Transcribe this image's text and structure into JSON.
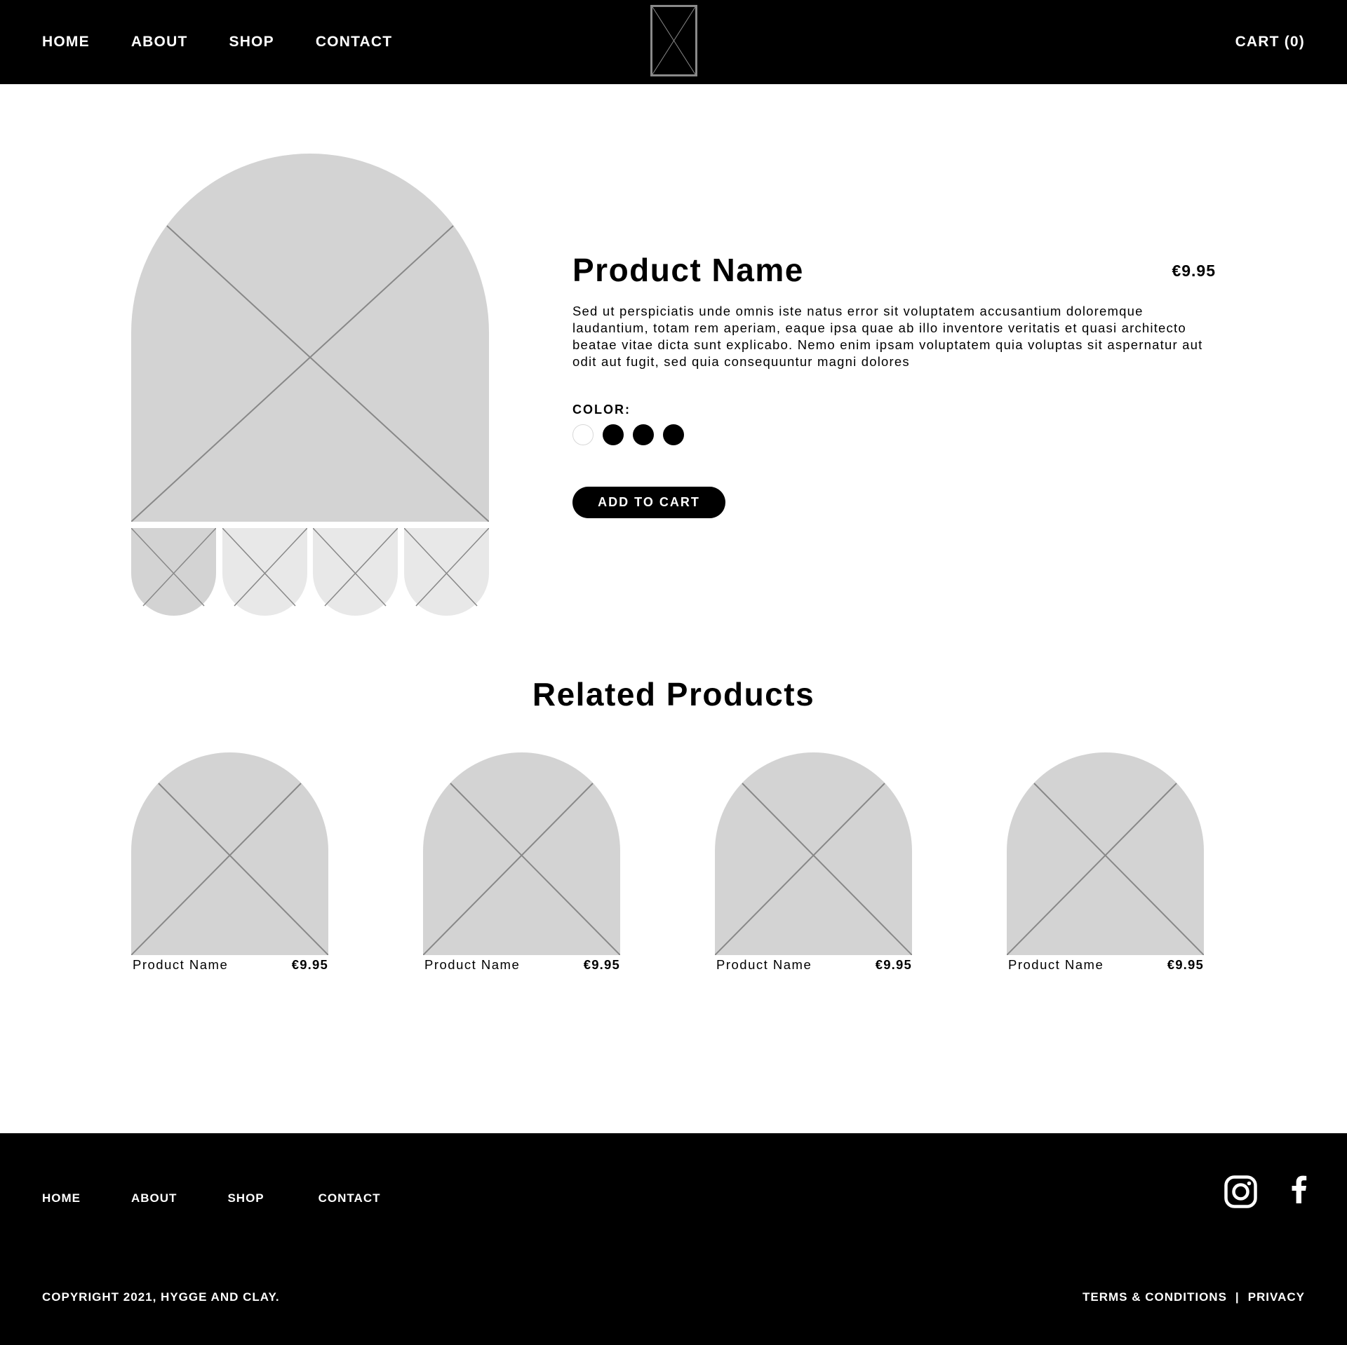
{
  "header": {
    "nav": [
      "HOME",
      "ABOUT",
      "SHOP",
      "CONTACT"
    ],
    "logo_icon": "logo-placeholder-icon",
    "cart_label": "CART (0)"
  },
  "product": {
    "name": "Product Name",
    "price": "€9.95",
    "description": "Sed ut perspiciatis unde omnis iste natus error sit voluptatem accusantium doloremque laudantium, totam rem aperiam, eaque ipsa quae ab illo inventore veritatis et quasi architecto beatae vitae dicta sunt explicabo. Nemo enim ipsam voluptatem quia voluptas sit aspernatur aut odit aut fugit, sed quia consequuntur magni dolores",
    "color_label": "COLOR:",
    "colors": [
      "#ffffff",
      "#000000",
      "#000000",
      "#000000"
    ],
    "add_to_cart_label": "ADD TO CART",
    "thumbnail_count": 4,
    "selected_thumbnail": 1
  },
  "related": {
    "title": "Related Products",
    "items": [
      {
        "name": "Product Name",
        "price": "€9.95"
      },
      {
        "name": "Product Name",
        "price": "€9.95"
      },
      {
        "name": "Product Name",
        "price": "€9.95"
      },
      {
        "name": "Product Name",
        "price": "€9.95"
      }
    ]
  },
  "footer": {
    "nav": [
      "HOME",
      "ABOUT",
      "SHOP",
      "CONTACT"
    ],
    "social_icons": [
      "instagram-icon",
      "facebook-icon"
    ],
    "copyright": "COPYRIGHT 2021, HYGGE AND CLAY.",
    "terms_label": "TERMS & CONDITIONS",
    "separator": "|",
    "privacy_label": "PRIVACY"
  },
  "colors": {
    "header_bg": "#000000",
    "placeholder": "#d3d3d3",
    "placeholder_light": "#e8e8e8",
    "placeholder_line": "#888888"
  }
}
